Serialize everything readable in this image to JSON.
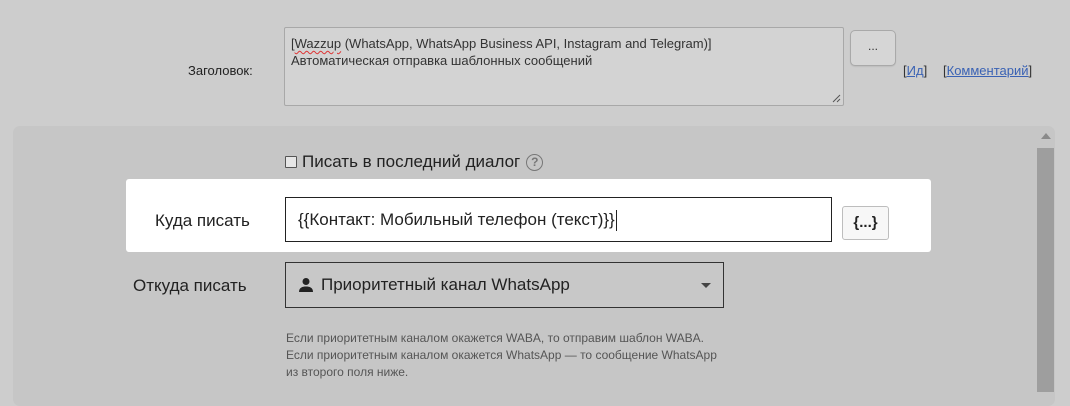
{
  "header": {
    "label": "Заголовок:",
    "title_line1_misspelled": "Wazzup",
    "title_line1_rest": " (WhatsApp, WhatsApp Business API, Instagram and Telegram)]",
    "title_line1_open": "[",
    "title_line2": "Автоматическая отправка шаблонных сообщений",
    "dots_button": "...",
    "links": {
      "id_open": "[",
      "id": "Ид",
      "id_close": "]",
      "comment_open": "[",
      "comment": "Комментарий",
      "comment_close": "]"
    }
  },
  "form": {
    "last_dialog_checkbox": {
      "label": "Писать в последний диалог",
      "checked": false,
      "help": "?"
    },
    "where": {
      "label": "Куда писать",
      "value": "{{Контакт: Мобильный телефон (текст)}}",
      "vars_button": "{...}"
    },
    "from": {
      "label": "Откуда писать",
      "selected": "Приоритетный канал WhatsApp",
      "icon": "user-icon"
    },
    "hint": [
      "Если приоритетным каналом окажется WABA, то отправим шаблон WABA.",
      "Если приоритетным каналом окажется WhatsApp — то сообщение WhatsApp",
      "из второго поля ниже."
    ]
  },
  "colors": {
    "background": "#cdcdcd",
    "panel": "#c6c6c6",
    "highlight": "#ffffff",
    "link": "#3a62b4"
  }
}
